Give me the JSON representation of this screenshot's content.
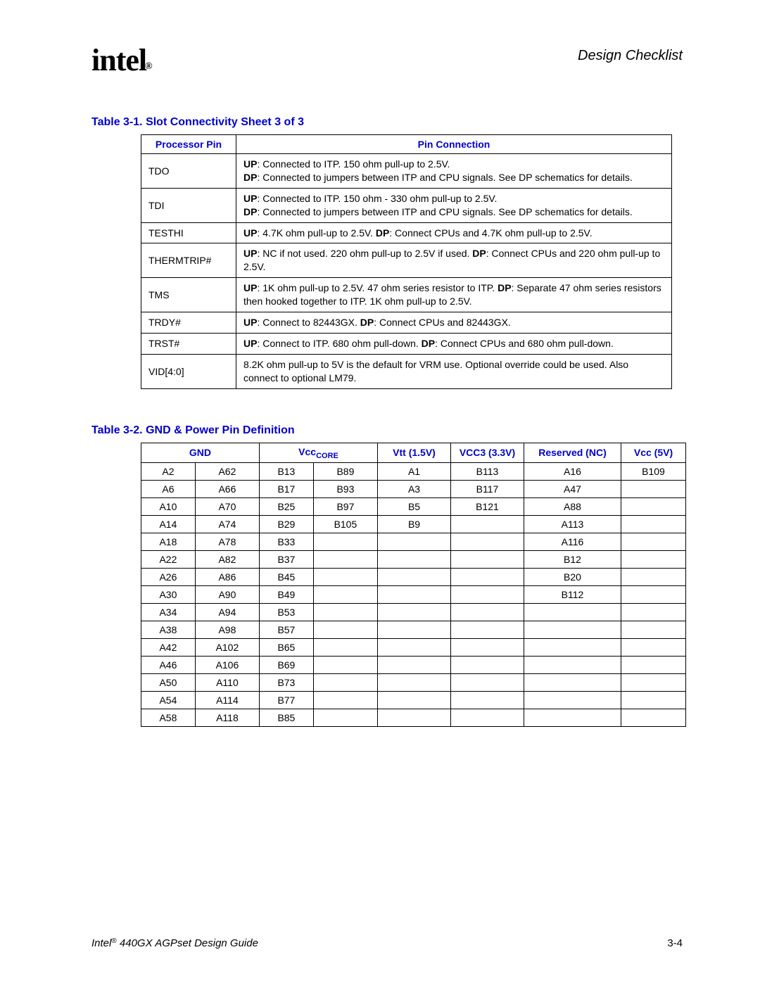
{
  "header": {
    "logo": "intel",
    "reg": "®",
    "section": "Design Checklist"
  },
  "table1": {
    "caption": "Table 3-1. Slot Connectivity Sheet 3 of 3",
    "headers": {
      "c0": "Processor Pin",
      "c1": "Pin Connection"
    },
    "rows": [
      {
        "pin": "TDO",
        "up": ": Connected to ITP. 150 ohm pull-up to 2.5V.",
        "dp": ": Connected to jumpers between ITP and CPU signals. See DP schematics for details."
      },
      {
        "pin": "TDI",
        "up": ": Connected to ITP. 150 ohm - 330 ohm pull-up to 2.5V.",
        "dp": ": Connected to jumpers between ITP and CPU signals. See DP schematics for details."
      },
      {
        "pin": "TESTHI",
        "single": true,
        "up": ": 4.7K ohm pull-up to 2.5V. ",
        "dp": ": Connect CPUs and 4.7K ohm pull-up to 2.5V."
      },
      {
        "pin": "THERMTRIP#",
        "up": ": NC if not used. 220 ohm pull-up to 2.5V if used. ",
        "dp": ": Connect CPUs and 220 ohm pull-up to 2.5V.",
        "inline": true
      },
      {
        "pin": "TMS",
        "up": ": 1K ohm pull-up to 2.5V. 47 ohm series resistor to ITP. ",
        "dp": ": Separate 47 ohm series resistors then hooked together to ITP. 1K ohm pull-up to 2.5V.",
        "inline": true
      },
      {
        "pin": "TRDY#",
        "single": true,
        "up": ": Connect to 82443GX. ",
        "dp": ": Connect CPUs and 82443GX."
      },
      {
        "pin": "TRST#",
        "single": true,
        "up": ": Connect to ITP. 680 ohm pull-down. ",
        "dp": ": Connect CPUs and 680 ohm pull-down."
      },
      {
        "pin": "VID[4:0]",
        "plain": "8.2K ohm pull-up to 5V is the default for VRM use. Optional override could be used. Also connect to optional LM79."
      }
    ]
  },
  "table2": {
    "caption": "Table 3-2. GND & Power Pin Definition",
    "headers": {
      "gnd": "GND",
      "vcccore_pre": "Vcc",
      "vcccore_sub": "CORE",
      "vtt": "Vtt (1.5V)",
      "vcc3": "VCC3 (3.3V)",
      "reserved": "Reserved (NC)",
      "vcc5": "Vcc (5V)"
    },
    "rows": [
      [
        "A2",
        "A62",
        "B13",
        "B89",
        "A1",
        "B113",
        "A16",
        "B109"
      ],
      [
        "A6",
        "A66",
        "B17",
        "B93",
        "A3",
        "B117",
        "A47",
        ""
      ],
      [
        "A10",
        "A70",
        "B25",
        "B97",
        "B5",
        "B121",
        "A88",
        ""
      ],
      [
        "A14",
        "A74",
        "B29",
        "B105",
        "B9",
        "",
        "A113",
        ""
      ],
      [
        "A18",
        "A78",
        "B33",
        "",
        "",
        "",
        "A116",
        ""
      ],
      [
        "A22",
        "A82",
        "B37",
        "",
        "",
        "",
        "B12",
        ""
      ],
      [
        "A26",
        "A86",
        "B45",
        "",
        "",
        "",
        "B20",
        ""
      ],
      [
        "A30",
        "A90",
        "B49",
        "",
        "",
        "",
        "B112",
        ""
      ],
      [
        "A34",
        "A94",
        "B53",
        "",
        "",
        "",
        "",
        ""
      ],
      [
        "A38",
        "A98",
        "B57",
        "",
        "",
        "",
        "",
        ""
      ],
      [
        "A42",
        "A102",
        "B65",
        "",
        "",
        "",
        "",
        ""
      ],
      [
        "A46",
        "A106",
        "B69",
        "",
        "",
        "",
        "",
        ""
      ],
      [
        "A50",
        "A110",
        "B73",
        "",
        "",
        "",
        "",
        ""
      ],
      [
        "A54",
        "A114",
        "B77",
        "",
        "",
        "",
        "",
        ""
      ],
      [
        "A58",
        "A118",
        "B85",
        "",
        "",
        "",
        "",
        ""
      ]
    ]
  },
  "footer": {
    "left_pre": "Intel",
    "reg": "®",
    "left_post": " 440GX AGPset Design Guide",
    "right": "3-4"
  }
}
